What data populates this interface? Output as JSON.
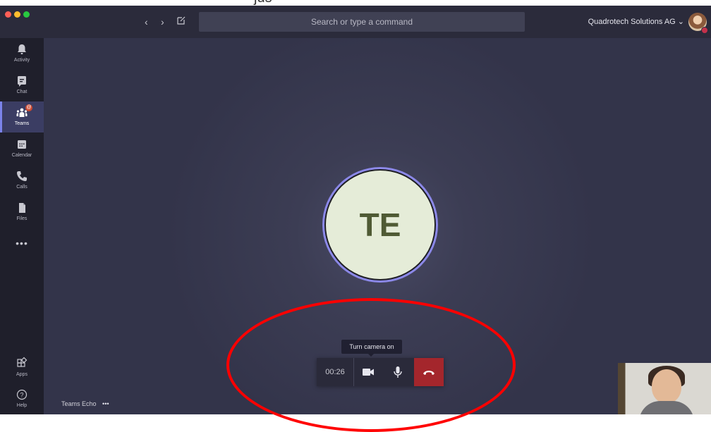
{
  "top_caption": "jus",
  "header": {
    "search_placeholder": "Search or type a command",
    "tenant_name": "Quadrotech Solutions AG",
    "tenant_chevron": "⌄"
  },
  "rail": {
    "items": [
      {
        "label": "Activity",
        "icon": "bell-icon"
      },
      {
        "label": "Chat",
        "icon": "chat-icon"
      },
      {
        "label": "Teams",
        "icon": "teams-icon",
        "badge": "@"
      },
      {
        "label": "Calendar",
        "icon": "calendar-icon"
      },
      {
        "label": "Calls",
        "icon": "phone-icon"
      },
      {
        "label": "Files",
        "icon": "file-icon"
      }
    ],
    "more": "•••",
    "bottom": [
      {
        "label": "Apps",
        "icon": "apps-icon"
      },
      {
        "label": "Help",
        "icon": "help-icon"
      }
    ]
  },
  "call": {
    "avatar_initials": "TE",
    "tooltip": "Turn camera on",
    "timer": "00:26",
    "name": "Teams Echo",
    "more": "•••"
  },
  "colors": {
    "accent": "#7b83eb",
    "hangup": "#a4262c",
    "annotation": "#ff0000"
  }
}
